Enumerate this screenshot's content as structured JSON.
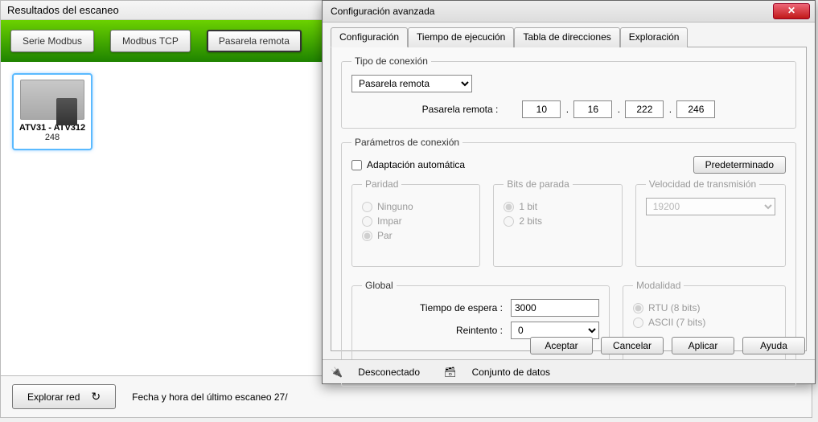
{
  "scan": {
    "title": "Resultados del escaneo",
    "buttons": {
      "serieModbus": "Serie Modbus",
      "modbusTcp": "Modbus TCP",
      "pasarelaRemota": "Pasarela remota"
    },
    "device": {
      "name": "ATV31 - ATV312",
      "addr": "248"
    },
    "exploreBtn": "Explorar red",
    "footerText": "Fecha y hora del último escaneo 27/"
  },
  "dlg": {
    "title": "Configuración avanzada",
    "tabs": [
      "Configuración",
      "Tiempo de ejecución",
      "Tabla de direcciones",
      "Exploración"
    ],
    "connType": {
      "legend": "Tipo de conexión",
      "selected": "Pasarela remota",
      "gatewayLabel": "Pasarela remota :",
      "ip": [
        "10",
        "16",
        "222",
        "246"
      ]
    },
    "params": {
      "legend": "Parámetros de conexión",
      "auto": "Adaptación automática",
      "defaultBtn": "Predeterminado",
      "parity": {
        "legend": "Paridad",
        "none": "Ninguno",
        "odd": "Impar",
        "even": "Par",
        "value": "Par"
      },
      "stopbits": {
        "legend": "Bits de parada",
        "one": "1 bit",
        "two": "2 bits",
        "value": "1 bit"
      },
      "baud": {
        "legend": "Velocidad de transmisión",
        "value": "19200"
      },
      "global": {
        "legend": "Global",
        "timeoutLabel": "Tiempo de espera :",
        "timeout": "3000",
        "retryLabel": "Reintento :",
        "retry": "0"
      },
      "mode": {
        "legend": "Modalidad",
        "rtu": "RTU (8 bits)",
        "ascii": "ASCII (7 bits)",
        "value": "RTU (8 bits)"
      }
    },
    "footer": {
      "ok": "Aceptar",
      "cancel": "Cancelar",
      "apply": "Aplicar",
      "help": "Ayuda"
    },
    "status": {
      "disconnected": "Desconectado",
      "dataset": "Conjunto de datos"
    }
  }
}
